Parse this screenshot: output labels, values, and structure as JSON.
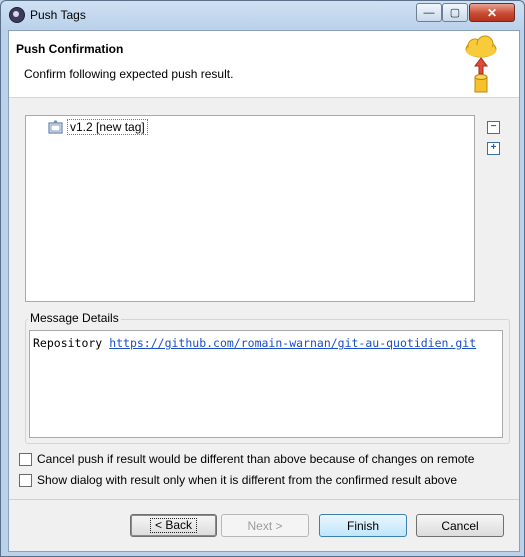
{
  "window": {
    "title": "Push Tags",
    "controls": {
      "minimize": "—",
      "maximize": "▢",
      "close": "✕"
    }
  },
  "header": {
    "title": "Push Confirmation",
    "description": "Confirm following expected push result."
  },
  "tree": {
    "items": [
      {
        "label": "v1.2 [new tag]",
        "icon": "tag-icon"
      }
    ],
    "collapse_icon": "collapse-all-icon",
    "expand_icon": "expand-all-icon"
  },
  "message_details": {
    "label": "Message Details",
    "repository_label": "Repository",
    "repository_url": "https://github.com/romain-warnan/git-au-quotidien.git"
  },
  "options": {
    "cancel_if_different": "Cancel push if result would be different than above because of changes on remote",
    "show_only_if_different": "Show dialog with result only when it is different from the confirmed result above"
  },
  "buttons": {
    "back": "< Back",
    "next": "Next >",
    "finish": "Finish",
    "cancel": "Cancel"
  },
  "colors": {
    "link": "#1a4fc7",
    "title_bar": "#b9d1ea",
    "close_button": "#c84b33"
  }
}
